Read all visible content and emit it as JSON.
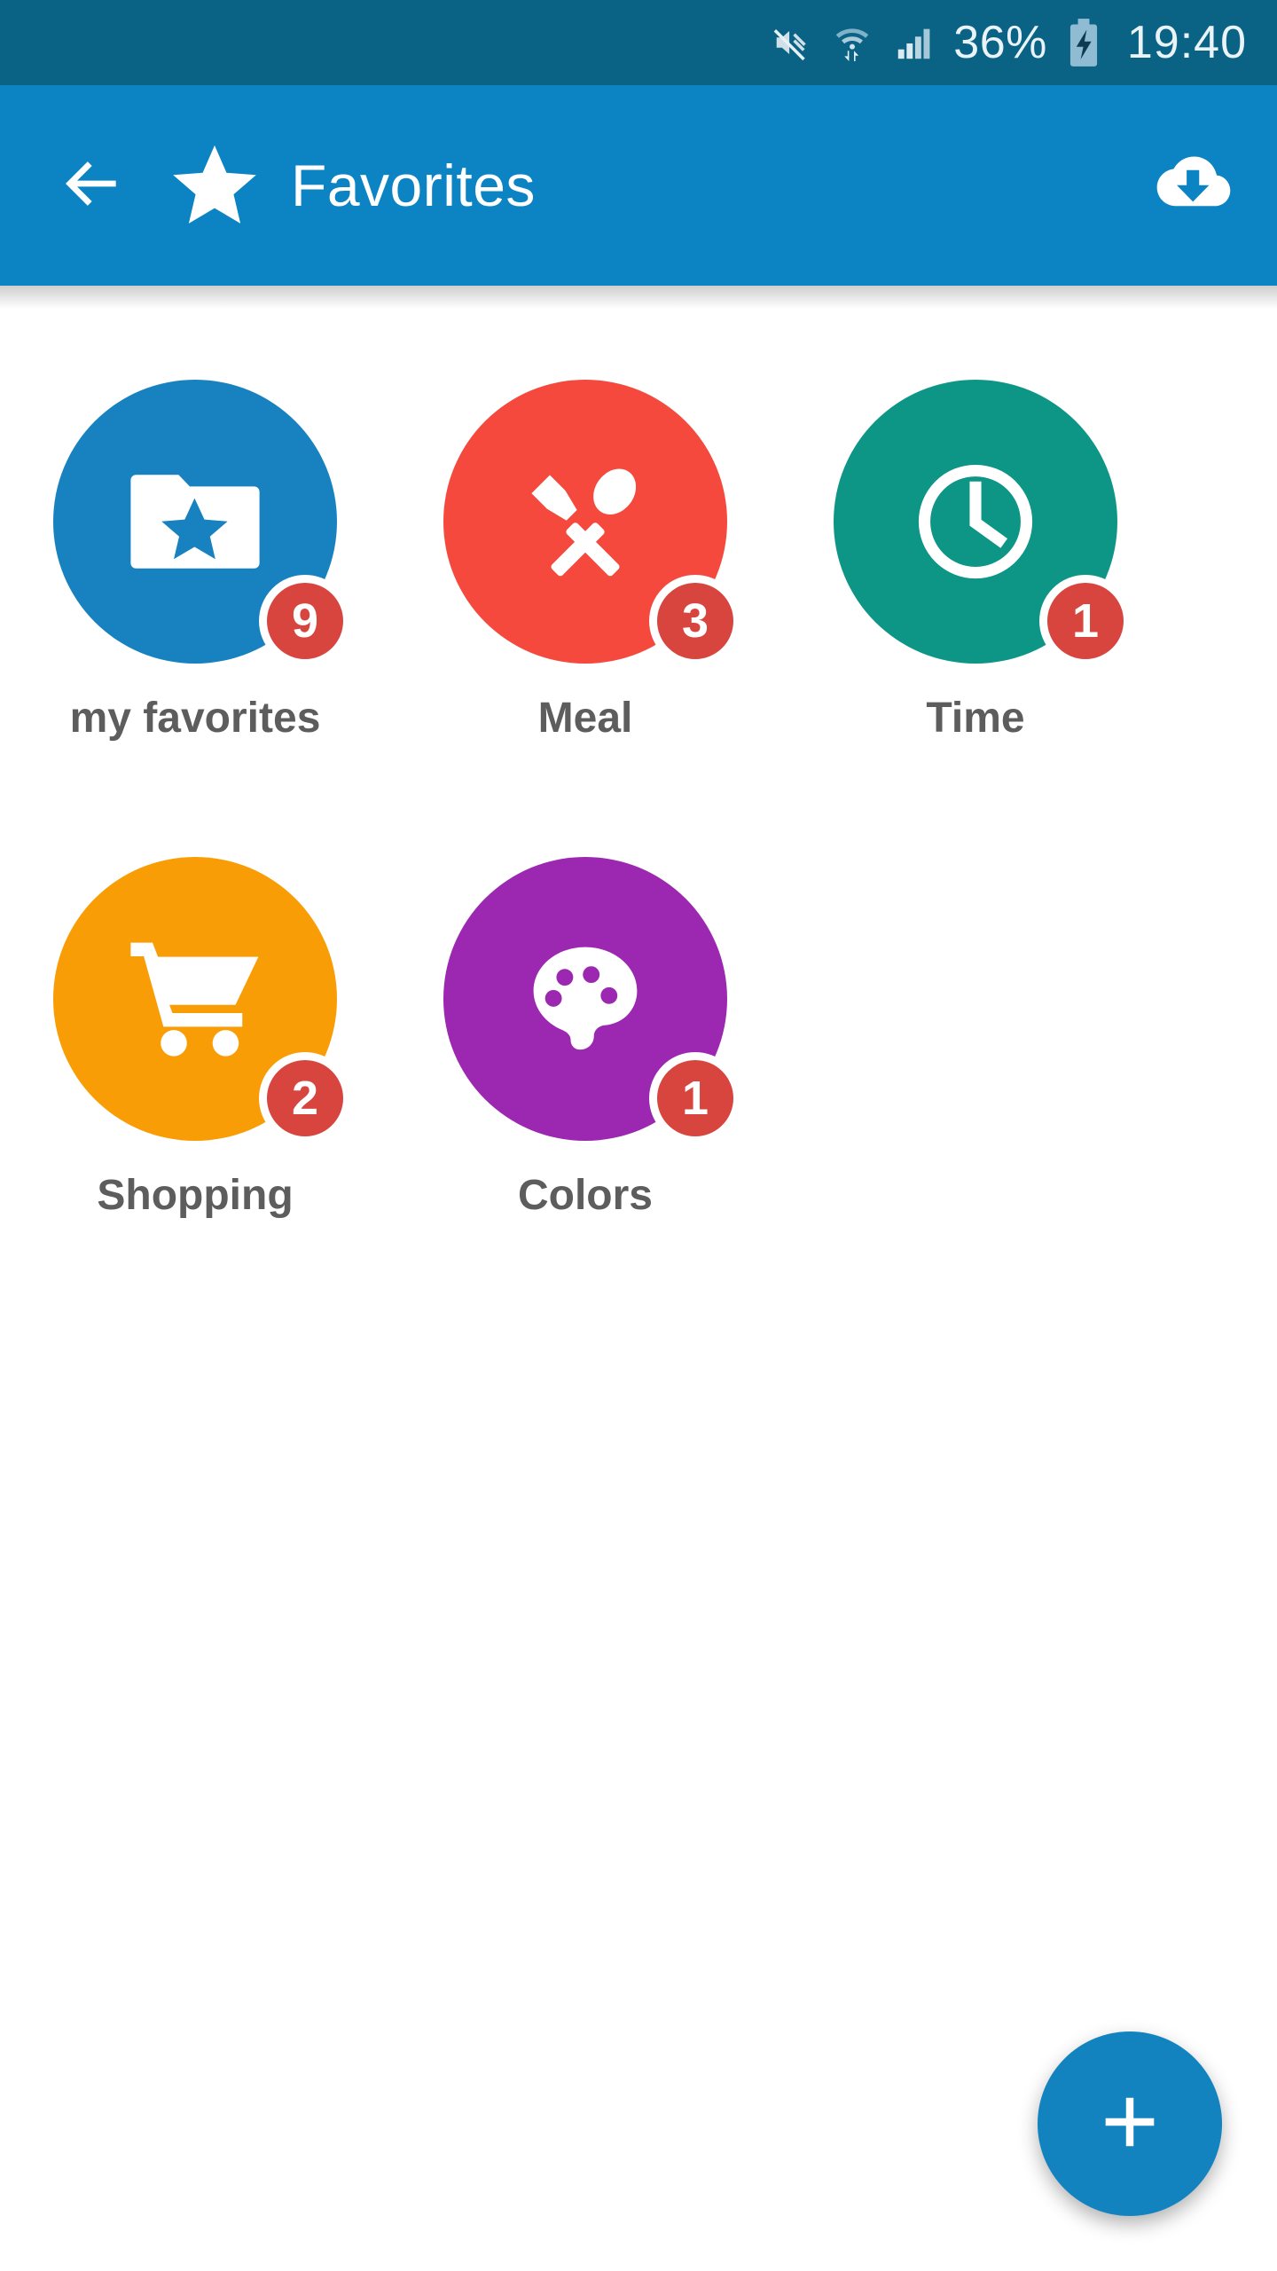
{
  "status_bar": {
    "background": "#0a6384",
    "mute_icon": "mute-icon",
    "wifi_icon": "wifi-transfer-icon",
    "signal_icon": "cellular-signal-icon",
    "battery_percent": "36%",
    "battery_icon": "battery-charging-icon",
    "clock": "19:40"
  },
  "app_bar": {
    "background": "#0c83c2",
    "back_icon": "back-arrow-icon",
    "brand_icon": "star-icon",
    "title": "Favorites",
    "action_icon": "cloud-download-icon"
  },
  "grid": {
    "items": [
      {
        "label": "my favorites",
        "badge": "9",
        "color": "#1782bf",
        "icon": "folder-star-icon"
      },
      {
        "label": "Meal",
        "badge": "3",
        "color": "#f4493c",
        "icon": "knife-spoon-icon"
      },
      {
        "label": "Time",
        "badge": "1",
        "color": "#0d9686",
        "icon": "clock-icon"
      },
      {
        "label": "Shopping",
        "badge": "2",
        "color": "#f99d07",
        "icon": "shopping-cart-icon"
      },
      {
        "label": "Colors",
        "badge": "1",
        "color": "#9c27b0",
        "icon": "paint-palette-icon"
      }
    ],
    "badge_color": "#d8453f",
    "label_color": "#5d5d5d"
  },
  "fab": {
    "icon": "plus-icon",
    "color": "#1383c0"
  }
}
